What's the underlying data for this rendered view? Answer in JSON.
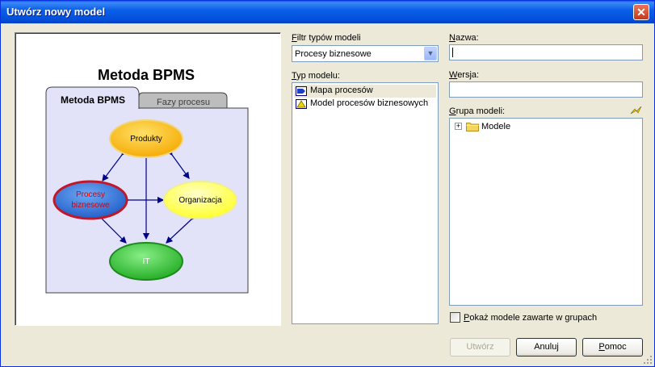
{
  "window": {
    "title": "Utwórz nowy model",
    "close_glyph": "✕"
  },
  "preview": {
    "heading": "Metoda BPMS",
    "tabs": [
      {
        "label": "Metoda BPMS",
        "active": true
      },
      {
        "label": "Fazy procesu",
        "active": false
      }
    ],
    "nodes": {
      "produkty": "Produkty",
      "procesy_line1": "Procesy",
      "procesy_line2": "biznesowe",
      "organizacja": "Organizacja",
      "it": "IT"
    }
  },
  "filter": {
    "label_u": "F",
    "label_rest": "iltr typów modeli",
    "selected": "Procesy biznesowe",
    "dropdown_icon": "chevron-down"
  },
  "model_type": {
    "label_u": "T",
    "label_rest": "yp modelu:",
    "items": [
      {
        "label": "Mapa procesów",
        "icon": "process-map-icon",
        "selected": true
      },
      {
        "label": "Model procesów biznesowych",
        "icon": "business-process-icon",
        "selected": false
      }
    ]
  },
  "name": {
    "label_u": "N",
    "label_rest": "azwa:",
    "value": ""
  },
  "version": {
    "label_u": "W",
    "label_rest": "ersja:",
    "value": ""
  },
  "group": {
    "label_u": "G",
    "label_rest": "rupa modeli:",
    "tree": [
      {
        "label": "Modele",
        "expander": "+"
      }
    ]
  },
  "show_grouped": {
    "label_u": "P",
    "label_rest": "okaż modele zawarte w grupach",
    "checked": false
  },
  "buttons": {
    "create": "Utwórz",
    "cancel": "Anuluj",
    "help_u": "P",
    "help_rest": "omoc"
  },
  "colors": {
    "titlebar": "#0a5bf0",
    "dialog_bg": "#ece9d8",
    "diagram_bg": "#e2e2f8",
    "produkty": "#f5a800",
    "procesy": "#2f6fd1",
    "organizacja": "#ffff33",
    "it": "#2fb82f",
    "arrow": "#00008b"
  }
}
